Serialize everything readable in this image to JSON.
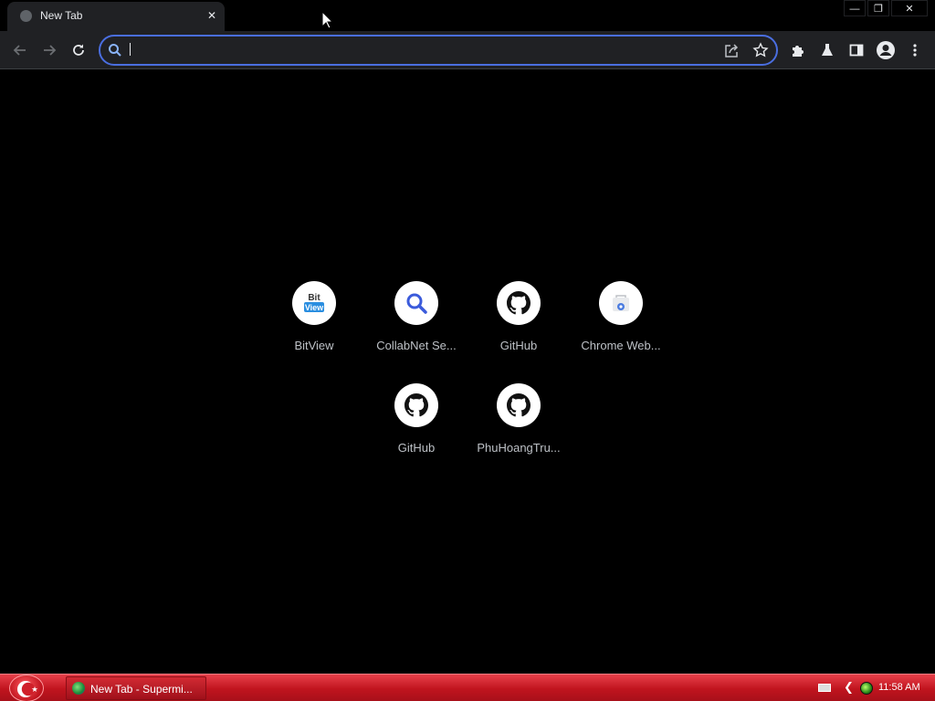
{
  "browser": {
    "tab": {
      "title": "New Tab",
      "close_glyph": "✕",
      "favicon": "globe-icon"
    },
    "window_controls": {
      "minimize": "—",
      "restore": "❐",
      "close": "✕"
    },
    "toolbar": {
      "back_icon": "back-arrow-icon",
      "forward_icon": "forward-arrow-icon",
      "reload_icon": "reload-icon",
      "omnibox": {
        "value": "",
        "placeholder": ""
      },
      "share_icon": "share-icon",
      "bookmark_icon": "star-icon",
      "extensions_icon": "puzzle-icon",
      "labs_icon": "flask-icon",
      "side_panel_icon": "side-panel-icon",
      "profile_icon": "avatar-icon",
      "menu_icon": "kebab-menu-icon"
    }
  },
  "ntp": {
    "shortcuts": [
      {
        "label": "BitView",
        "icon": "bitview-icon"
      },
      {
        "label": "CollabNet Se...",
        "icon": "search-icon"
      },
      {
        "label": "GitHub",
        "icon": "github-icon"
      },
      {
        "label": "Chrome Web...",
        "icon": "chrome-web-store-icon"
      },
      {
        "label": "GitHub",
        "icon": "github-icon"
      },
      {
        "label": "PhuHoangTru...",
        "icon": "github-icon"
      }
    ]
  },
  "taskbar": {
    "task_label": "New Tab - Supermi...",
    "clock": "11:58 AM"
  },
  "colors": {
    "page_bg": "#000000",
    "chrome_bg": "#202124",
    "omnibox_focus": "#4a6ee0",
    "taskbar_red": "#c0141e"
  }
}
